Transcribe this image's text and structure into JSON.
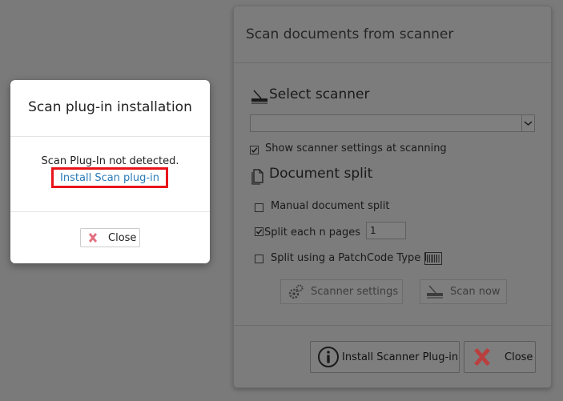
{
  "main_dialog": {
    "title": "Scan documents from scanner",
    "select_scanner": {
      "heading": "Select scanner",
      "selected_value": "",
      "show_settings_label": "Show scanner settings at scanning",
      "show_settings_checked": true
    },
    "document_split": {
      "heading": "Document split",
      "manual_label": "Manual document split",
      "manual_checked": false,
      "each_n_label": "Split each n pages",
      "each_n_checked": true,
      "n_pages_value": "1",
      "patchcode_label": "Split using a PatchCode Type I",
      "patchcode_checked": false
    },
    "scanner_settings_button": "Scanner settings",
    "scan_now_button": "Scan now",
    "install_plugin_button": "Install Scanner Plug-in",
    "close_button": "Close"
  },
  "modal": {
    "title": "Scan plug-in installation",
    "message": "Scan Plug-In not detected.",
    "install_link": "Install Scan plug-in",
    "close_button": "Close"
  },
  "colors": {
    "overlay": "#7a7a7a",
    "link": "#2a7ab8",
    "highlight": "#e8141a",
    "close_x": "#b9403f",
    "modal_close_x": "#e36e7f"
  },
  "icons": {
    "scanner": "scanner-icon",
    "document": "document-pages-icon",
    "gear": "gear-icon",
    "info": "info-circle-icon",
    "close_x": "close-x-icon",
    "barcode": "barcode-icon",
    "dropdown": "chevron-down-icon",
    "check": "checkmark-icon"
  }
}
